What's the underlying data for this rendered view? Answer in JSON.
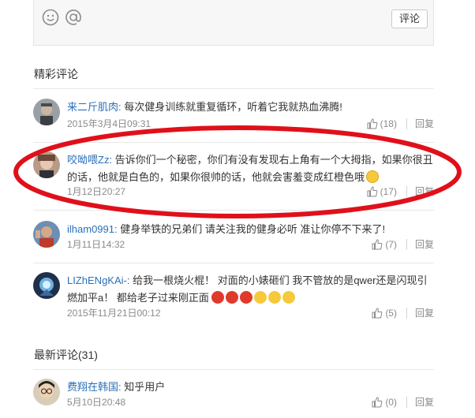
{
  "composer": {
    "submit_label": "评论"
  },
  "sections": {
    "featured_title": "精彩评论",
    "latest_title": "最新评论(31)"
  },
  "featured": [
    {
      "author": "来二斤肌肉:",
      "text": " 每次健身训练就重复循环，听着它我就热血沸腾!",
      "time": "2015年3月4日09:31",
      "likes": "(18)",
      "reply": "回复"
    },
    {
      "author": "咬呦喂Zz:",
      "text": " 告诉你们一个秘密，你们有没有发现右上角有一个大拇指，如果你很丑的话，他就是白色的，如果你很帅的话，他就会害羞变成红橙色哦",
      "time": "1月12日20:27",
      "likes": "(17)",
      "reply": "回复"
    },
    {
      "author": "ilham0991:",
      "text": " 健身举铁的兄弟们 请关注我的健身必听 准让你停不下来了!",
      "time": "1月11日14:32",
      "likes": "(7)",
      "reply": "回复"
    },
    {
      "author": "LIZhENgKAi-:",
      "text": " 给我一根烧火棍！ 对面的小婊砸们 我不管放的是qwer还是闪现引燃加平a！ 都给老子过来刚正面",
      "time": "2015年11月21日00:12",
      "likes": "(5)",
      "reply": "回复"
    }
  ],
  "latest": [
    {
      "author": "费翔在韩国:",
      "text": " 知乎用户",
      "time": "5月10日20:48",
      "likes": "(0)",
      "reply": "回复"
    }
  ],
  "colors": {
    "link": "#2a6fb8",
    "annotation": "#e0101a"
  }
}
